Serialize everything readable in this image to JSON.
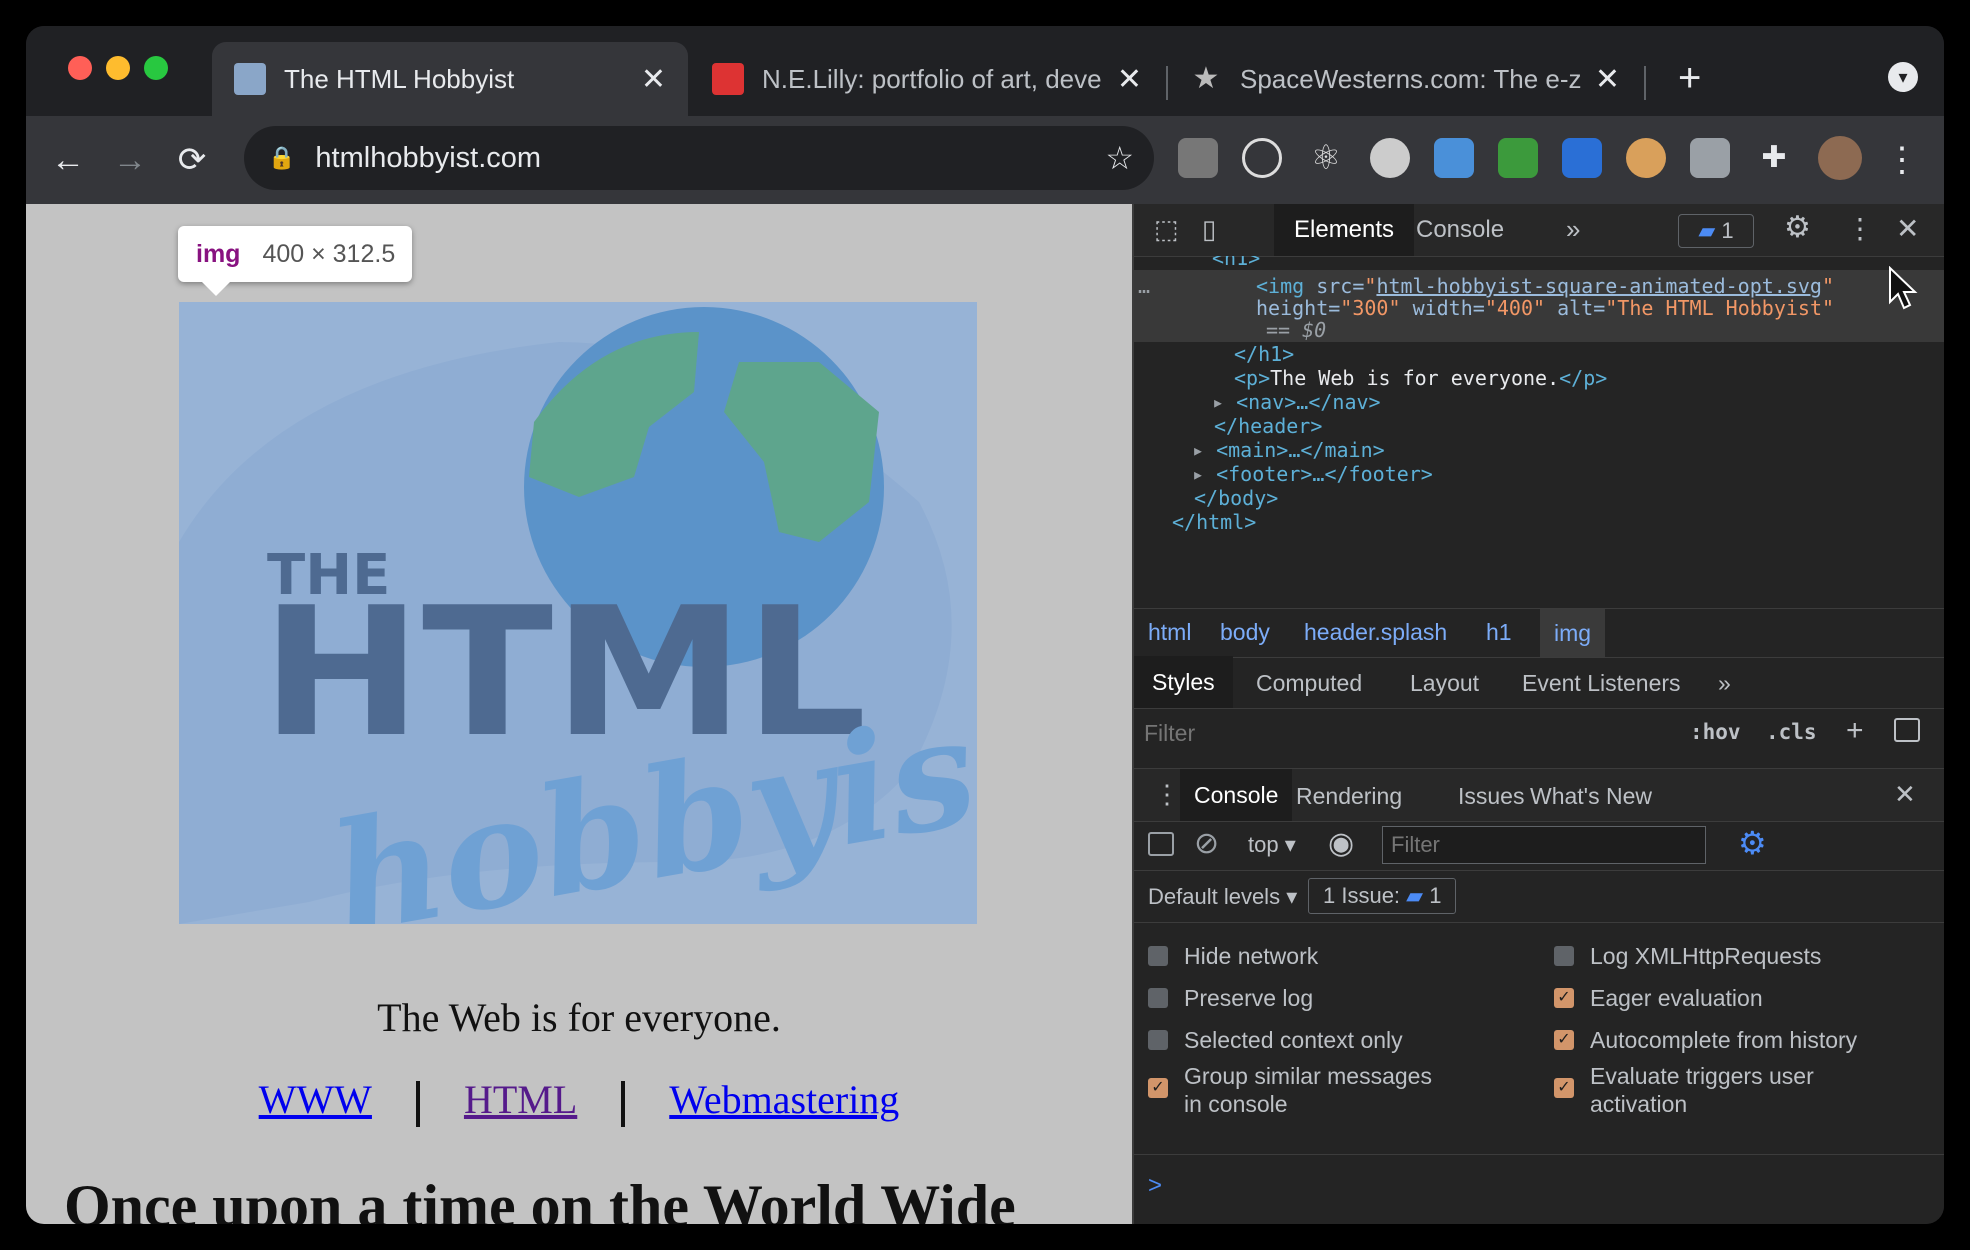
{
  "browser": {
    "tabs": [
      {
        "title": "The HTML Hobbyist",
        "active": true
      },
      {
        "title": "N.E.Lilly: portfolio of art, development"
      },
      {
        "title": "SpaceWesterns.com: The e-zine"
      }
    ],
    "new_tab_label": "+",
    "url": "htmlhobbyist.com"
  },
  "page": {
    "tooltip": {
      "tag": "img",
      "size": "400 × 312.5"
    },
    "logo_text": {
      "the": "THE",
      "html": "HTML",
      "hobbyist": "hobbyist"
    },
    "tagline": "The Web is for everyone.",
    "nav_links": [
      "WWW",
      "HTML",
      "Webmastering"
    ],
    "heading": "Once upon a time on the World Wide"
  },
  "devtools": {
    "tabs": [
      "Elements",
      "Console"
    ],
    "issue_count": "1",
    "code": {
      "l0": "<h1>",
      "img_src": "html-hobbyist-square-animated-opt.svg",
      "img_height": "300",
      "img_width": "400",
      "img_alt": "The HTML Hobbyist",
      "sel": "== $0",
      "h1_close": "</h1>",
      "p_text": "The Web is for everyone.",
      "nav": "<nav>…</nav>",
      "header_close": "</header>",
      "main": "<main>…</main>",
      "footer": "<footer>…</footer>",
      "body_close": "</body>",
      "html_close": "</html>"
    },
    "breadcrumbs": [
      "html",
      "body",
      "header.splash",
      "h1",
      "img"
    ],
    "subtabs": [
      "Styles",
      "Computed",
      "Layout",
      "Event Listeners"
    ],
    "filter_placeholder": "Filter",
    "hov": ":hov",
    "cls": ".cls",
    "drawer_tabs": [
      "Console",
      "Rendering",
      "Issues",
      "What's New"
    ],
    "context": "top",
    "console_filter_placeholder": "Filter",
    "default_levels": "Default levels",
    "issue_label": "1 Issue:",
    "issue_badge": "1",
    "settings_left": [
      {
        "label": "Hide network",
        "checked": false
      },
      {
        "label": "Preserve log",
        "checked": false
      },
      {
        "label": "Selected context only",
        "checked": false
      },
      {
        "label": "Group similar messages in console",
        "checked": true
      }
    ],
    "settings_right": [
      {
        "label": "Log XMLHttpRequests",
        "checked": false
      },
      {
        "label": "Eager evaluation",
        "checked": true
      },
      {
        "label": "Autocomplete from history",
        "checked": true
      },
      {
        "label": "Evaluate triggers user activation",
        "checked": true
      }
    ],
    "prompt": ">"
  },
  "colors": {
    "link": "#0000ee",
    "visited_link": "#551a8b",
    "accent": "#7cacf8"
  }
}
